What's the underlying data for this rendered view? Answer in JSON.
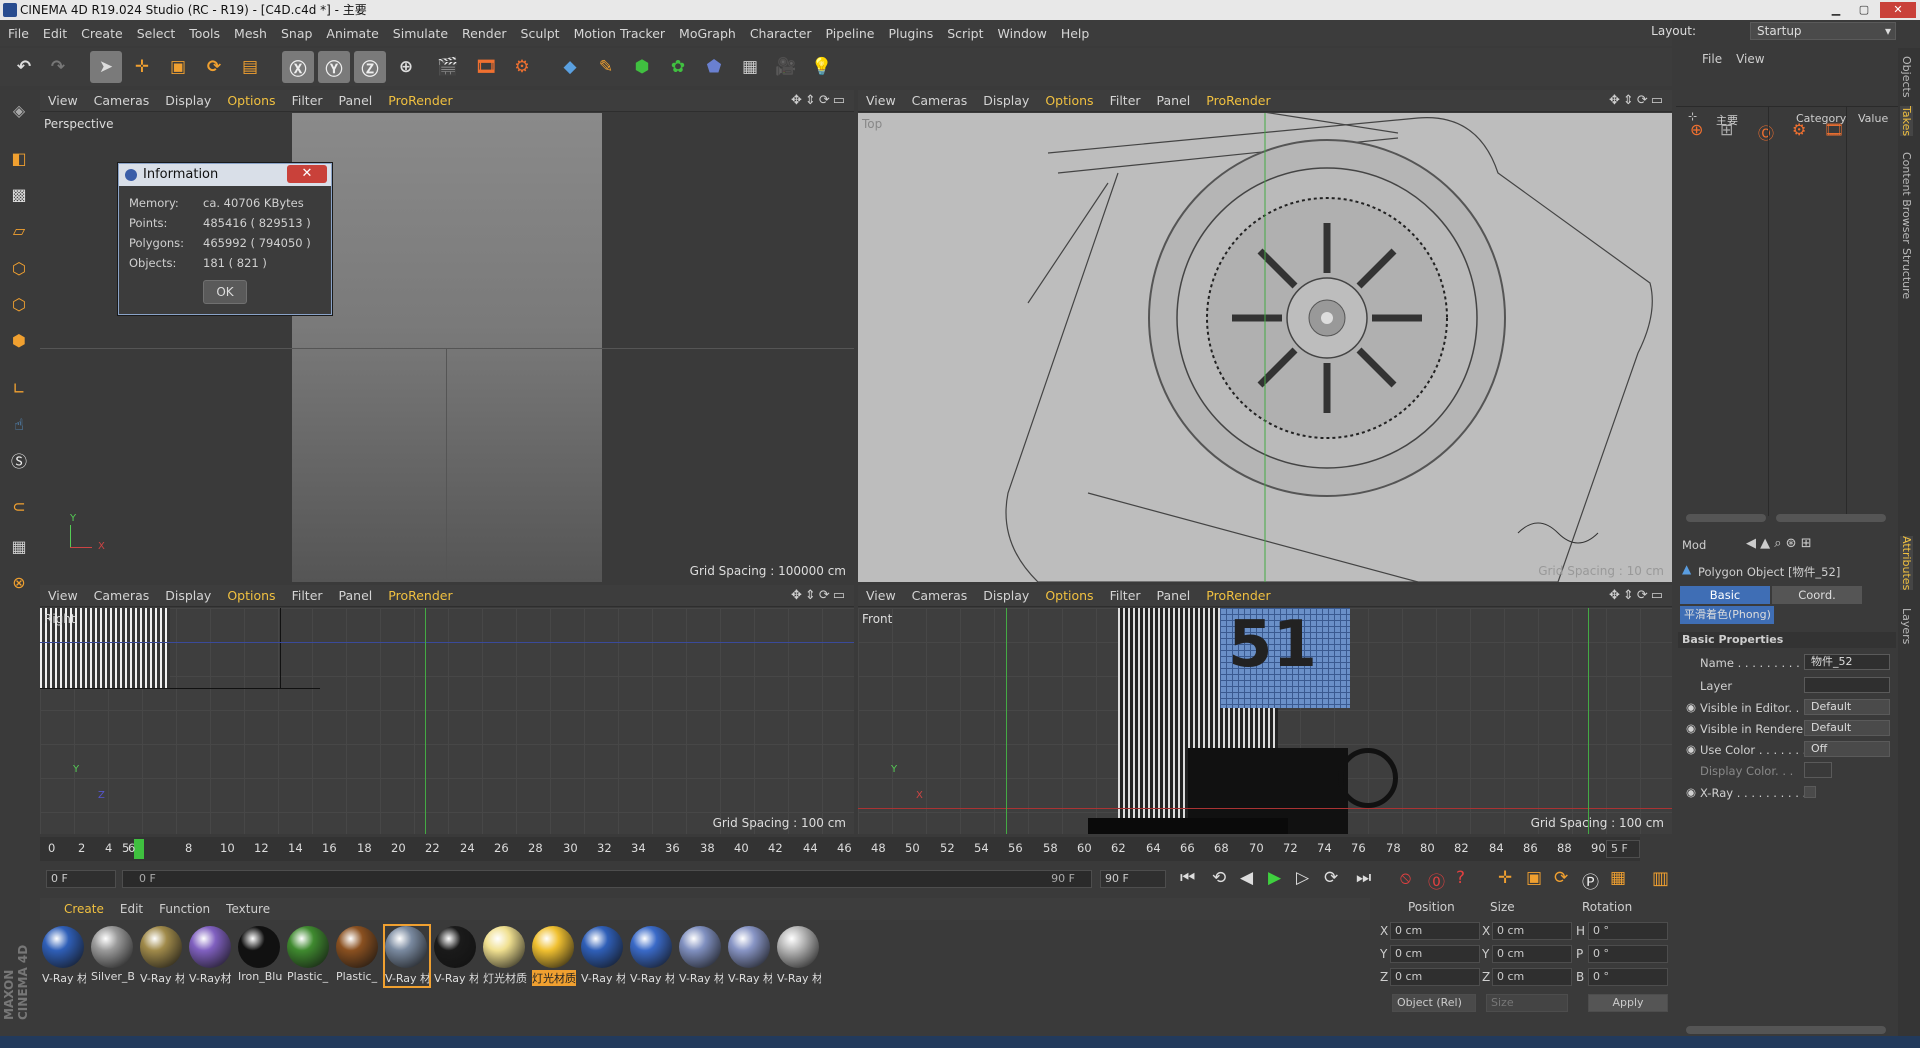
{
  "window": {
    "title": "CINEMA 4D R19.024 Studio (RC - R19) - [C4D.c4d *] - 主要",
    "layout_label": "Layout:",
    "layout_value": "Startup"
  },
  "menu": [
    "File",
    "Edit",
    "Create",
    "Select",
    "Tools",
    "Mesh",
    "Snap",
    "Animate",
    "Simulate",
    "Render",
    "Sculpt",
    "Motion Tracker",
    "MoGraph",
    "Character",
    "Pipeline",
    "Plugins",
    "Script",
    "Window",
    "Help"
  ],
  "viewport_menu": {
    "view": "View",
    "cameras": "Cameras",
    "display": "Display",
    "options": "Options",
    "filter": "Filter",
    "panel": "Panel",
    "prorender": "ProRender"
  },
  "viewports": {
    "perspective": {
      "label": "Perspective",
      "grid": "Grid Spacing : 100000 cm"
    },
    "top": {
      "label": "Top",
      "grid": "Grid Spacing : 10 cm"
    },
    "right": {
      "label": "Right",
      "grid": "Grid Spacing : 100 cm"
    },
    "front": {
      "label": "Front",
      "grid": "Grid Spacing : 100 cm"
    }
  },
  "dialog": {
    "title": "Information",
    "memory_label": "Memory:",
    "memory_value": "ca. 40706 KBytes",
    "points_label": "Points:",
    "points_value": "485416 ( 829513 )",
    "polygons_label": "Polygons:",
    "polygons_value": "465992 ( 794050 )",
    "objects_label": "Objects:",
    "objects_value": "181 ( 821 )",
    "ok": "OK"
  },
  "timeline": {
    "ticks": [
      "0",
      "2",
      "4",
      "5",
      "6",
      "8",
      "10",
      "12",
      "14",
      "16",
      "18",
      "20",
      "22",
      "24",
      "26",
      "28",
      "30",
      "32",
      "34",
      "36",
      "38",
      "40",
      "42",
      "44",
      "46",
      "48",
      "50",
      "52",
      "54",
      "56",
      "58",
      "60",
      "62",
      "64",
      "66",
      "68",
      "70",
      "72",
      "74",
      "76",
      "78",
      "80",
      "82",
      "84",
      "86",
      "88",
      "90"
    ],
    "end_field": "5 F",
    "current_frame": "0 F",
    "range_start": "0 F",
    "range_end": "90 F",
    "max_frame": "90 F"
  },
  "material_menu": {
    "create": "Create",
    "edit": "Edit",
    "function": "Function",
    "texture": "Texture"
  },
  "materials": [
    {
      "name": "V-Ray 材",
      "color": "#2f5fb8"
    },
    {
      "name": "Silver_B",
      "color": "#9a9a9a"
    },
    {
      "name": "V-Ray 材",
      "color": "#a08a4a"
    },
    {
      "name": "V-Ray材",
      "color": "#8060c0"
    },
    {
      "name": "Iron_Blu",
      "color": "#111111"
    },
    {
      "name": "Plastic_",
      "color": "#3f8a2f"
    },
    {
      "name": "Plastic_",
      "color": "#8a5020"
    },
    {
      "name": "V-Ray 材",
      "color": "#7a8aa0"
    },
    {
      "name": "V-Ray 材",
      "color": "#1a1a1a"
    },
    {
      "name": "灯光材质",
      "color": "#f0e090"
    },
    {
      "name": "灯光材质",
      "color": "#f0c030"
    },
    {
      "name": "V-Ray 材",
      "color": "#2f5fb8"
    },
    {
      "name": "V-Ray 材",
      "color": "#3a6ac8"
    },
    {
      "name": "V-Ray 材",
      "color": "#8090c0"
    },
    {
      "name": "V-Ray 材",
      "color": "#8895c5"
    },
    {
      "name": "V-Ray 材",
      "color": "#b8b8b8"
    }
  ],
  "coords": {
    "position_label": "Position",
    "size_label": "Size",
    "rotation_label": "Rotation",
    "px": "0 cm",
    "py": "0 cm",
    "pz": "0 cm",
    "sx": "0 cm",
    "sy": "0 cm",
    "sz": "0 cm",
    "rh": "0 °",
    "rp": "0 °",
    "rb": "0 °",
    "mode": "Object (Rel)",
    "size_mode": "Size",
    "apply": "Apply"
  },
  "object_manager": {
    "file": "File",
    "view": "View",
    "col_name": "主要",
    "col_category": "Category",
    "col_value": "Value"
  },
  "attributes": {
    "mode": "Mod",
    "title": "Polygon Object [物件_52]",
    "tab_basic": "Basic",
    "tab_coord": "Coord.",
    "phong": "平滑着色(Phong)",
    "section": "Basic Properties",
    "name_label": "Name . . . . . . . . . . .",
    "name_value": "物件_52",
    "layer_label": "Layer",
    "vis_editor_label": "Visible in Editor. . .",
    "vis_editor_value": "Default",
    "vis_render_label": "Visible in Renderer",
    "vis_render_value": "Default",
    "use_color_label": "Use Color . . . . . . .",
    "use_color_value": "Off",
    "display_color_label": "Display Color. . .",
    "xray_label": "X-Ray . . . . . . . . . ."
  },
  "side_tabs": [
    "Objects",
    "Takes",
    "Content Browser",
    "Structure",
    "Attributes",
    "Layers"
  ],
  "brand": "MAXON CINEMA 4D"
}
